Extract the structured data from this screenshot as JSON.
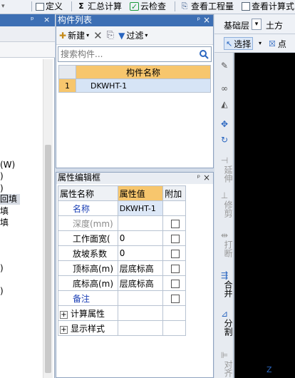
{
  "topbar": {
    "items": [
      {
        "icon": "define-icon",
        "label": "定义"
      },
      {
        "icon": "sigma-icon",
        "label": "汇总计算"
      },
      {
        "icon": "cloud-check-icon",
        "label": "云检查"
      },
      {
        "icon": "quantity-icon",
        "label": "查看工程量"
      },
      {
        "icon": "formula-icon",
        "label": "查看计算式"
      }
    ]
  },
  "left_panel": {
    "items": [
      "(W)",
      ")",
      ")",
      "回填",
      "填",
      "填",
      ")",
      ")"
    ]
  },
  "component_list": {
    "title": "构件列表",
    "toolbar": {
      "new_label": "新建",
      "filter_label": "过滤"
    },
    "search_placeholder": "搜索构件...",
    "column_header": "构件名称",
    "rows": [
      {
        "index": "1",
        "name": "DKWHT-1"
      }
    ]
  },
  "property_editor": {
    "title": "属性编辑框",
    "headers": {
      "name": "属性名称",
      "value": "属性值",
      "extra": "附加"
    },
    "rows": [
      {
        "name": "名称",
        "value": "DKWHT-1",
        "has_check": false,
        "style": "blue"
      },
      {
        "name": "深度(mm)",
        "value": "",
        "has_check": true,
        "style": "gray"
      },
      {
        "name": "工作面宽(",
        "value": "0",
        "has_check": true,
        "style": "normal"
      },
      {
        "name": "放坡系数",
        "value": "0",
        "has_check": true,
        "style": "normal"
      },
      {
        "name": "顶标高(m)",
        "value": "层底标高",
        "has_check": true,
        "style": "normal"
      },
      {
        "name": "底标高(m)",
        "value": "层底标高",
        "has_check": true,
        "style": "normal"
      },
      {
        "name": "备注",
        "value": "",
        "has_check": true,
        "style": "blue"
      }
    ],
    "groups": [
      "计算属性",
      "显示样式"
    ]
  },
  "right_toolbar": {
    "layer_select": "基础层",
    "category_label": "土方",
    "select_label": "选择",
    "point_label": "点",
    "vertical_tools": [
      "延伸",
      "修剪",
      "打断",
      "合并",
      "分割",
      "对齐"
    ]
  }
}
